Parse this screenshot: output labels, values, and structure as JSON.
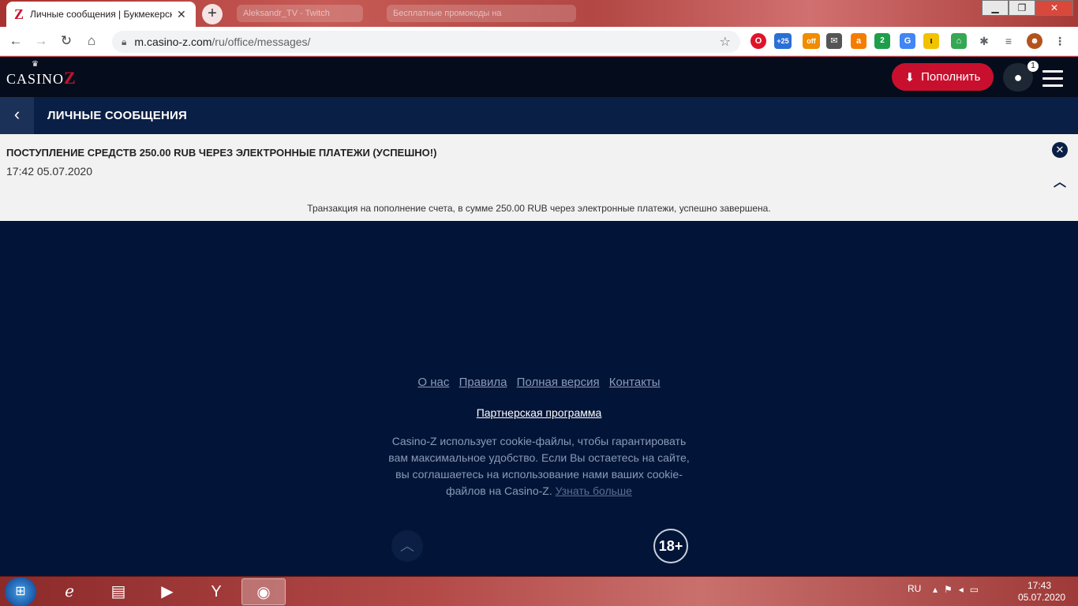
{
  "browser": {
    "active_tab_title": "Личные сообщения | Букмекерская",
    "background_tabs": [
      "Aleksandr_TV - Twitch",
      "Бесплатные промокоды на"
    ],
    "url_host": "m.casino-z.com",
    "url_path": "/ru/office/messages/",
    "extension_badges": [
      "+25",
      "off",
      "2"
    ]
  },
  "site": {
    "logo": "CASINO",
    "logo_letter": "Z",
    "deposit_label": "Пополнить",
    "notification_count": "1",
    "brand_color": "#c8102e"
  },
  "page": {
    "title": "ЛИЧНЫЕ СООБЩЕНИЯ"
  },
  "message": {
    "title": "ПОСТУПЛЕНИЕ СРЕДСТВ 250.00 RUB ЧЕРЕЗ ЭЛЕКТРОННЫЕ ПЛАТЕЖИ (УСПЕШНО!)",
    "date": "17:42 05.07.2020",
    "body": "Транзакция на пополнение счета, в сумме 250.00 RUB через электронные платежи, успешно завершена."
  },
  "footer": {
    "links": [
      "О нас",
      "Правила",
      "Полная версия",
      "Контакты"
    ],
    "partner": "Партнерская программа",
    "cookie_text": "Casino-Z использует cookie-файлы, чтобы гарантировать вам максимальное удобство. Если Вы остаетесь на сайте, вы соглашаетесь на использование нами ваших cookie-файлов на Casino-Z.",
    "cookie_more": "Узнать больше",
    "age": "18+"
  },
  "taskbar": {
    "language": "RU",
    "time": "17:43",
    "date": "05.07.2020"
  }
}
